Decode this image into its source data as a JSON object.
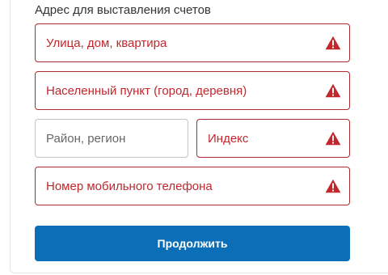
{
  "billing": {
    "title": "Адрес для выставления счетов",
    "fields": {
      "street": {
        "placeholder": "Улица, дом, квартира",
        "state": "error"
      },
      "city": {
        "placeholder": "Населенный пункт (город, деревня)",
        "state": "error"
      },
      "region": {
        "placeholder": "Район, регион",
        "state": "normal"
      },
      "postal_code": {
        "placeholder": "Индекс",
        "state": "error"
      },
      "phone": {
        "placeholder": "Номер мобильного телефона",
        "state": "error"
      }
    },
    "submit_label": "Продолжить"
  },
  "colors": {
    "error": "#c1272d",
    "error_border": "#ab2b31",
    "primary_button": "#0b6fb8",
    "normal_border": "#c4c4c4"
  },
  "icons": {
    "field_error": "warning-triangle-icon"
  }
}
